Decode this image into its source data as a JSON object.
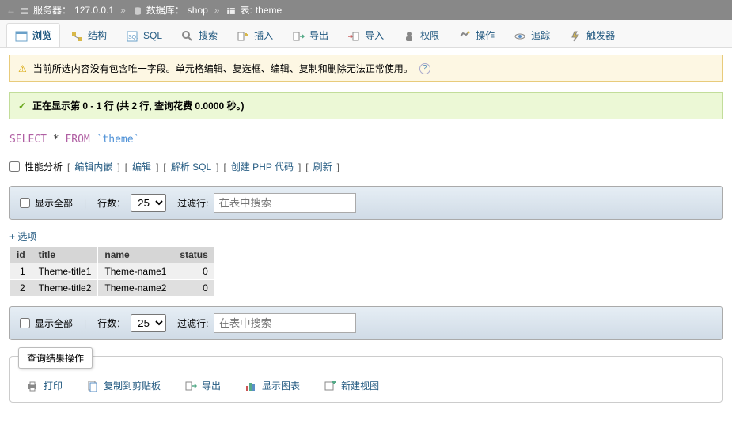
{
  "breadcrumb": {
    "server_label": "服务器：",
    "server_value": "127.0.0.1",
    "db_label": "数据库：",
    "db_value": "shop",
    "table_label": "表:",
    "table_value": "theme"
  },
  "tabs": [
    {
      "label": "浏览",
      "active": true
    },
    {
      "label": "结构"
    },
    {
      "label": "SQL"
    },
    {
      "label": "搜索"
    },
    {
      "label": "插入"
    },
    {
      "label": "导出"
    },
    {
      "label": "导入"
    },
    {
      "label": "权限"
    },
    {
      "label": "操作"
    },
    {
      "label": "追踪"
    },
    {
      "label": "触发器"
    }
  ],
  "warning": "当前所选内容没有包含唯一字段。单元格编辑、复选框、编辑、复制和删除无法正常使用。",
  "success": "正在显示第 0 - 1 行 (共 2 行, 查询花费 0.0000 秒。)",
  "sql": {
    "select": "SELECT",
    "star": "*",
    "from": "FROM",
    "table": "`theme`"
  },
  "analysis": {
    "checkbox_label": "性能分析",
    "links": [
      "编辑内嵌",
      "编辑",
      "解析 SQL",
      "创建 PHP 代码",
      "刷新"
    ]
  },
  "filter": {
    "show_all": "显示全部",
    "rows_label": "行数：",
    "rows_value": "25",
    "filter_label": "过滤行:",
    "search_placeholder": "在表中搜索"
  },
  "options_link": "+ 选项",
  "table": {
    "headers": [
      "id",
      "title",
      "name",
      "status"
    ],
    "rows": [
      {
        "id": "1",
        "title": "Theme-title1",
        "name": "Theme-name1",
        "status": "0"
      },
      {
        "id": "2",
        "title": "Theme-title2",
        "name": "Theme-name2",
        "status": "0"
      }
    ]
  },
  "ops": {
    "title": "查询结果操作",
    "items": [
      "打印",
      "复制到剪贴板",
      "导出",
      "显示图表",
      "新建视图"
    ]
  }
}
